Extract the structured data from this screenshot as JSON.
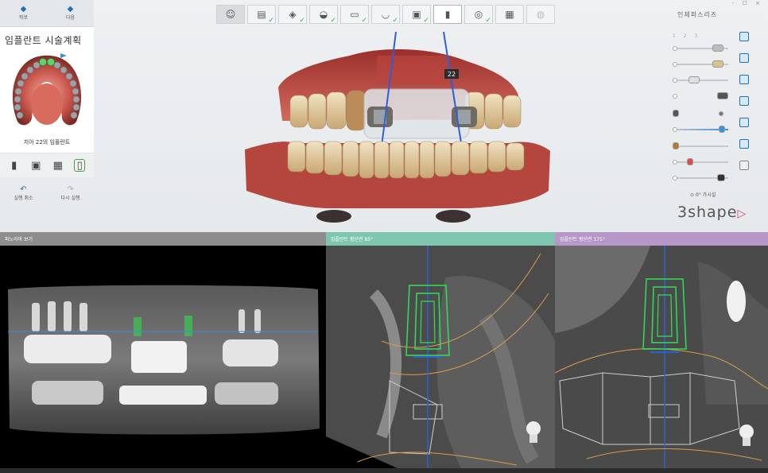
{
  "nav": {
    "back_label": "뒤로",
    "next_label": "다음"
  },
  "panel": {
    "title": "임플란트 시술계획",
    "tooth_caption": "치아 22의 임플란트",
    "undo_label": "실행 취소",
    "redo_label": "다시 실행"
  },
  "implant_label": "22",
  "workflow_steps": [
    {
      "icon": "avatar-icon",
      "done": false
    },
    {
      "icon": "scan-icon",
      "done": true
    },
    {
      "icon": "align-icon",
      "done": true
    },
    {
      "icon": "tooth-icon",
      "done": true
    },
    {
      "icon": "view-icon",
      "done": true
    },
    {
      "icon": "crown-icon",
      "done": true
    },
    {
      "icon": "implant-icon",
      "done": true
    },
    {
      "icon": "implant-current-icon",
      "done": false
    },
    {
      "icon": "sleeve-icon",
      "done": true
    },
    {
      "icon": "guide-icon",
      "done": true
    },
    {
      "icon": "export-icon",
      "done": false
    }
  ],
  "right_panel": {
    "title": "인체파스리즈",
    "window_controls": "- ☐ ×",
    "page_tabs": [
      "1",
      "2",
      "3"
    ],
    "lower_control_label": "0° 가시설",
    "logo_text": "3shape"
  },
  "views": {
    "pano_title": "파노라마 보기",
    "cs1_title": "임플란트 횡단면 85°",
    "cs2_title": "임플란트 횡단면 175°"
  },
  "colors": {
    "accent": "#1f72b8",
    "check": "#37b24d",
    "pano_header": "#8d8d8d",
    "cs1_header": "#7fc6b1",
    "cs2_header": "#b796c8",
    "logo_triangle": "#e8355e"
  }
}
